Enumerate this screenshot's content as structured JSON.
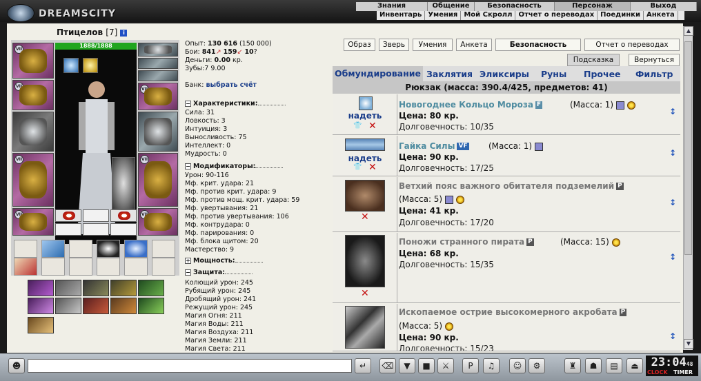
{
  "logo": {
    "text": "DREAMSCITY"
  },
  "top_menu": {
    "row1": [
      "Знания",
      "Общение",
      "Безопасность",
      "Персонаж",
      "Выход"
    ],
    "row2": [
      "Инвентарь",
      "Умения",
      "Мой Скролл",
      "Отчет о переводах",
      "Поединки",
      "Анкета"
    ]
  },
  "character": {
    "name": "Птицелов",
    "level": "[7]",
    "info_icon": "i",
    "hp": "1888/1888",
    "exp_label": "Опыт:",
    "exp_value": "130 616",
    "exp_next": "(150 000)",
    "fights_label": "Бои:",
    "wins": "841",
    "losses": "159",
    "draws": "10",
    "money_label": "Деньги:",
    "money_value": "0.00",
    "money_unit": "кр.",
    "teeth_label": "Зубы:",
    "teeth_value": "7 9.00",
    "bank_label": "Банк:",
    "bank_link": "выбрать счёт"
  },
  "sections": {
    "characteristics": {
      "title": "Характеристики:",
      "lines": [
        "Сила: 31",
        "Ловкость: 3",
        "Интуиция: 3",
        "Выносливость: 75",
        "Интеллект: 0",
        "Мудрость: 0"
      ]
    },
    "modifiers": {
      "title": "Модификаторы:",
      "lines": [
        "Урон: 90-116",
        "Мф. крит. удара: 21",
        "Мф. против крит. удара: 9",
        "Мф. против мощ. крит. удара: 59",
        "Мф. увертывания: 21",
        "Мф. против увертывания: 106",
        "Мф. контрудара: 0",
        "Мф. парирования: 0",
        "Мф. блока щитом: 20",
        "Мастерство: 9"
      ]
    },
    "power": {
      "title": "Мощность:"
    },
    "defense": {
      "title": "Защита:",
      "lines": [
        "Колющий урон: 245",
        "Рубящий урон: 245",
        "Дробящий урон: 241",
        "Режущий урон: 245",
        "Магия Огня: 211",
        "Магия Воды: 211",
        "Магия Воздуха: 211",
        "Магия Земли: 211",
        "Магия Света: 211"
      ]
    }
  },
  "right_buttons": [
    "Образ",
    "Зверь",
    "Умения",
    "Анкета",
    "Безопасность",
    "Отчет о переводах"
  ],
  "sub_buttons": [
    "Подсказка",
    "Вернуться"
  ],
  "tabs": [
    "Обмундирование",
    "Заклятия",
    "Эликсиры",
    "Руны",
    "Прочее",
    "Фильтр"
  ],
  "bag_header": "Рюкзак (масса: 390.4/425, предметов: 41)",
  "items": [
    {
      "name": "Новогоднее Кольцо Мороза",
      "tag": "F",
      "mass": "(Масса: 1)",
      "price": "Цена: 80 кр.",
      "durability": "Долговечность: 10/35",
      "wear": "надеть"
    },
    {
      "name": "Гайка Силы",
      "tag": "VF",
      "mass": "(Масса: 1)",
      "price": "Цена: 90 кр.",
      "durability": "Долговечность: 17/25",
      "wear": "надеть"
    },
    {
      "name": "Ветхий пояс важного обитателя подземелий",
      "tag": "P",
      "mass": "(Масса: 5)",
      "price": "Цена: 41 кр.",
      "durability": "Долговечность: 17/20",
      "wear": ""
    },
    {
      "name": "Поножи странного пирата",
      "tag": "P",
      "mass": "(Масса: 15)",
      "price": "Цена: 68 кр.",
      "durability": "Долговечность: 15/35",
      "wear": ""
    },
    {
      "name": "Ископаемое острие высокомерного акробата",
      "tag": "P",
      "mass": "(Масса: 5)",
      "price": "Цена: 90 кр.",
      "durability": "Долговечность: 15/23",
      "wear": ""
    }
  ],
  "clock": {
    "time": "23:04",
    "seconds": "48",
    "clock_label": "CLOCK",
    "timer_label": "TIMER"
  },
  "colors": {
    "accent": "#1a3d8a",
    "hp": "#21a51f",
    "item_name": "#4f8ca0",
    "delete": "#c41010"
  }
}
